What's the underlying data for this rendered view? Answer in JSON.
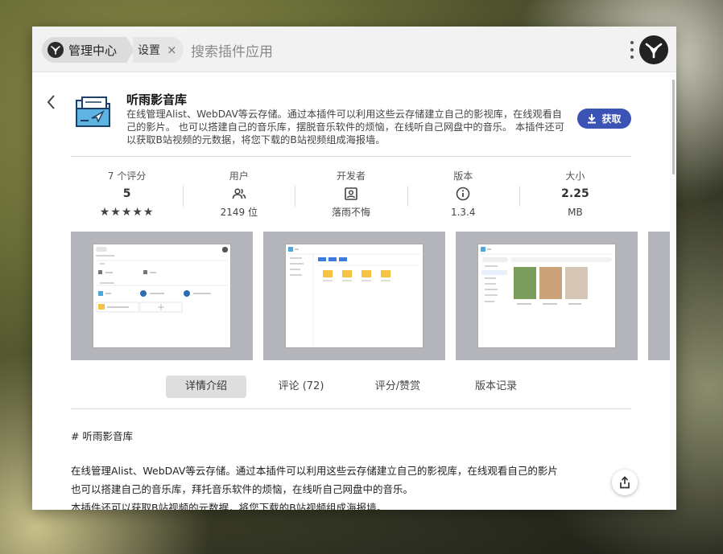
{
  "topbar": {
    "home_label": "管理中心",
    "settings_label": "设置",
    "close_glyph": "×",
    "search_placeholder": "搜索插件应用",
    "icons": [
      "logo-icon",
      "more-vert-icon",
      "app-logo-icon"
    ]
  },
  "app": {
    "title": "听雨影音库",
    "description": "在线管理Alist、WebDAV等云存储。通过本插件可以利用这些云存储建立自己的影视库，在线观看自己的影片。 也可以搭建自己的音乐库，摆脱音乐软件的烦恼，在线听自己网盘中的音乐。 本插件还可以获取B站视频的元数据，将您下载的B站视频组成海报墙。",
    "get_label": "获取",
    "accent": "#3b53b5"
  },
  "stats": [
    {
      "label": "7 个评分",
      "main": "5",
      "sub": "★★★★★"
    },
    {
      "label": "用户",
      "icon": "users-icon",
      "sub": "2149 位"
    },
    {
      "label": "开发者",
      "icon": "developer-badge-icon",
      "sub": "落雨不悔"
    },
    {
      "label": "版本",
      "icon": "info-icon",
      "sub": "1.3.4"
    },
    {
      "label": "大小",
      "main": "2.25",
      "sub": "MB"
    }
  ],
  "screenshots_count": 4,
  "tabs": [
    {
      "label": "详情介绍",
      "active": true
    },
    {
      "label": "评论 (72)",
      "active": false
    },
    {
      "label": "评分/赞赏",
      "active": false
    },
    {
      "label": "版本记录",
      "active": false
    }
  ],
  "readme": {
    "heading": "# 听雨影音库",
    "line1": "在线管理Alist、WebDAV等云存储。通过本插件可以利用这些云存储建立自己的影视库，在线观看自己的影片",
    "line2": "也可以搭建自己的音乐库，拜托音乐软件的烦恼，在线听自己网盘中的音乐。",
    "line3": "本插件还可以获取B站视频的元数据，将您下载的B站视频组成海报墙。"
  }
}
